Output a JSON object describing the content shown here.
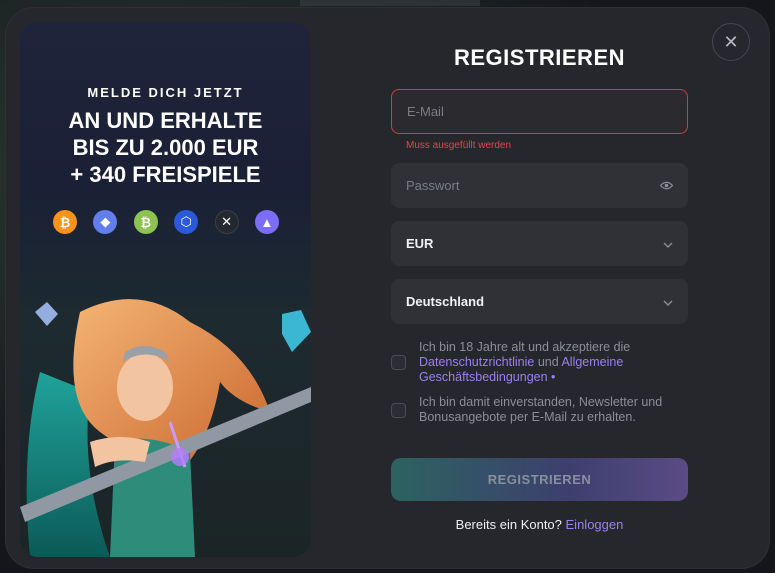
{
  "promo": {
    "subtitle": "MELDE DICH JETZT",
    "title_lines": [
      "AN UND ERHALTE",
      "BIS ZU 2.000 EUR",
      "+ 340 FREISPIELE"
    ],
    "crypto_icons": [
      {
        "name": "bitcoin-icon",
        "glyph": "₿",
        "color": "#f7931a"
      },
      {
        "name": "ethereum-icon",
        "glyph": "◆",
        "color": "#627eea"
      },
      {
        "name": "bitcoin-cash-icon",
        "glyph": "₿",
        "color": "#8dc351"
      },
      {
        "name": "chainlink-icon",
        "glyph": "⬡",
        "color": "#2a5ada"
      },
      {
        "name": "ripple-icon",
        "glyph": "✕",
        "color": "#23292f"
      },
      {
        "name": "tron-icon",
        "glyph": "▲",
        "color": "#7b6ef6"
      }
    ]
  },
  "form": {
    "title": "REGISTRIEREN",
    "email_placeholder": "E-Mail",
    "email_error": "Muss ausgefüllt werden",
    "password_placeholder": "Passwort",
    "currency_value": "EUR",
    "country_value": "Deutschland",
    "terms": {
      "prefix": "Ich bin 18 Jahre alt und akzeptiere die ",
      "privacy_link": "Datenschutzrichtlinie",
      "and": " und ",
      "terms_link": "Allgemeine Geschäftsbedingungen",
      "required_mark": " •"
    },
    "newsletter_text": "Ich bin damit einverstanden, Newsletter und Bonusangebote per E-Mail zu erhalten.",
    "submit_label": "REGISTRIEREN",
    "login_prompt": "Bereits ein Konto?",
    "login_link": "Einloggen"
  },
  "colors": {
    "accent": "#9a80f0",
    "error": "#e04848",
    "modal_bg": "#26272d",
    "field_bg": "#2f3137"
  }
}
